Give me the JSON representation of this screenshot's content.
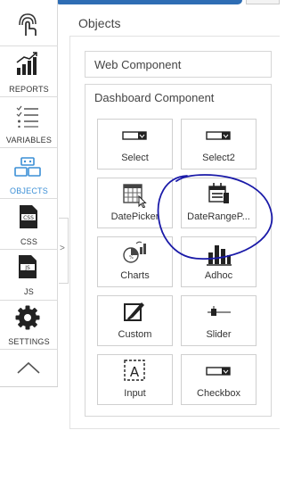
{
  "sidebar": {
    "items": [
      {
        "label": "",
        "icon": "touch-icon"
      },
      {
        "label": "REPORTS",
        "icon": "bar-chart-icon"
      },
      {
        "label": "VARIABLES",
        "icon": "list-icon"
      },
      {
        "label": "OBJECTS",
        "icon": "blocks-icon",
        "active": true
      },
      {
        "label": "CSS",
        "icon": "css-file-icon"
      },
      {
        "label": "JS",
        "icon": "js-file-icon"
      },
      {
        "label": "SETTINGS",
        "icon": "gear-icon"
      },
      {
        "label": "",
        "icon": "chevron-up-icon"
      }
    ],
    "collapse_glyph": ">"
  },
  "panel": {
    "title": "Objects",
    "web_component": "Web Component",
    "dashboard_component": "Dashboard Component",
    "tiles": [
      {
        "label": "Select",
        "icon": "select-icon"
      },
      {
        "label": "Select2",
        "icon": "select2-icon"
      },
      {
        "label": "DatePicker",
        "icon": "datepicker-icon"
      },
      {
        "label": "DateRangeP...",
        "icon": "daterange-icon"
      },
      {
        "label": "Charts",
        "icon": "charts-icon"
      },
      {
        "label": "Adhoc",
        "icon": "adhoc-icon"
      },
      {
        "label": "Custom",
        "icon": "custom-icon"
      },
      {
        "label": "Slider",
        "icon": "slider-icon"
      },
      {
        "label": "Input",
        "icon": "input-icon"
      },
      {
        "label": "Checkbox",
        "icon": "checkbox-icon"
      }
    ]
  },
  "colors": {
    "accent": "#3b8fd6",
    "annotation": "#1a1aa8",
    "dark_icon": "#222222"
  }
}
